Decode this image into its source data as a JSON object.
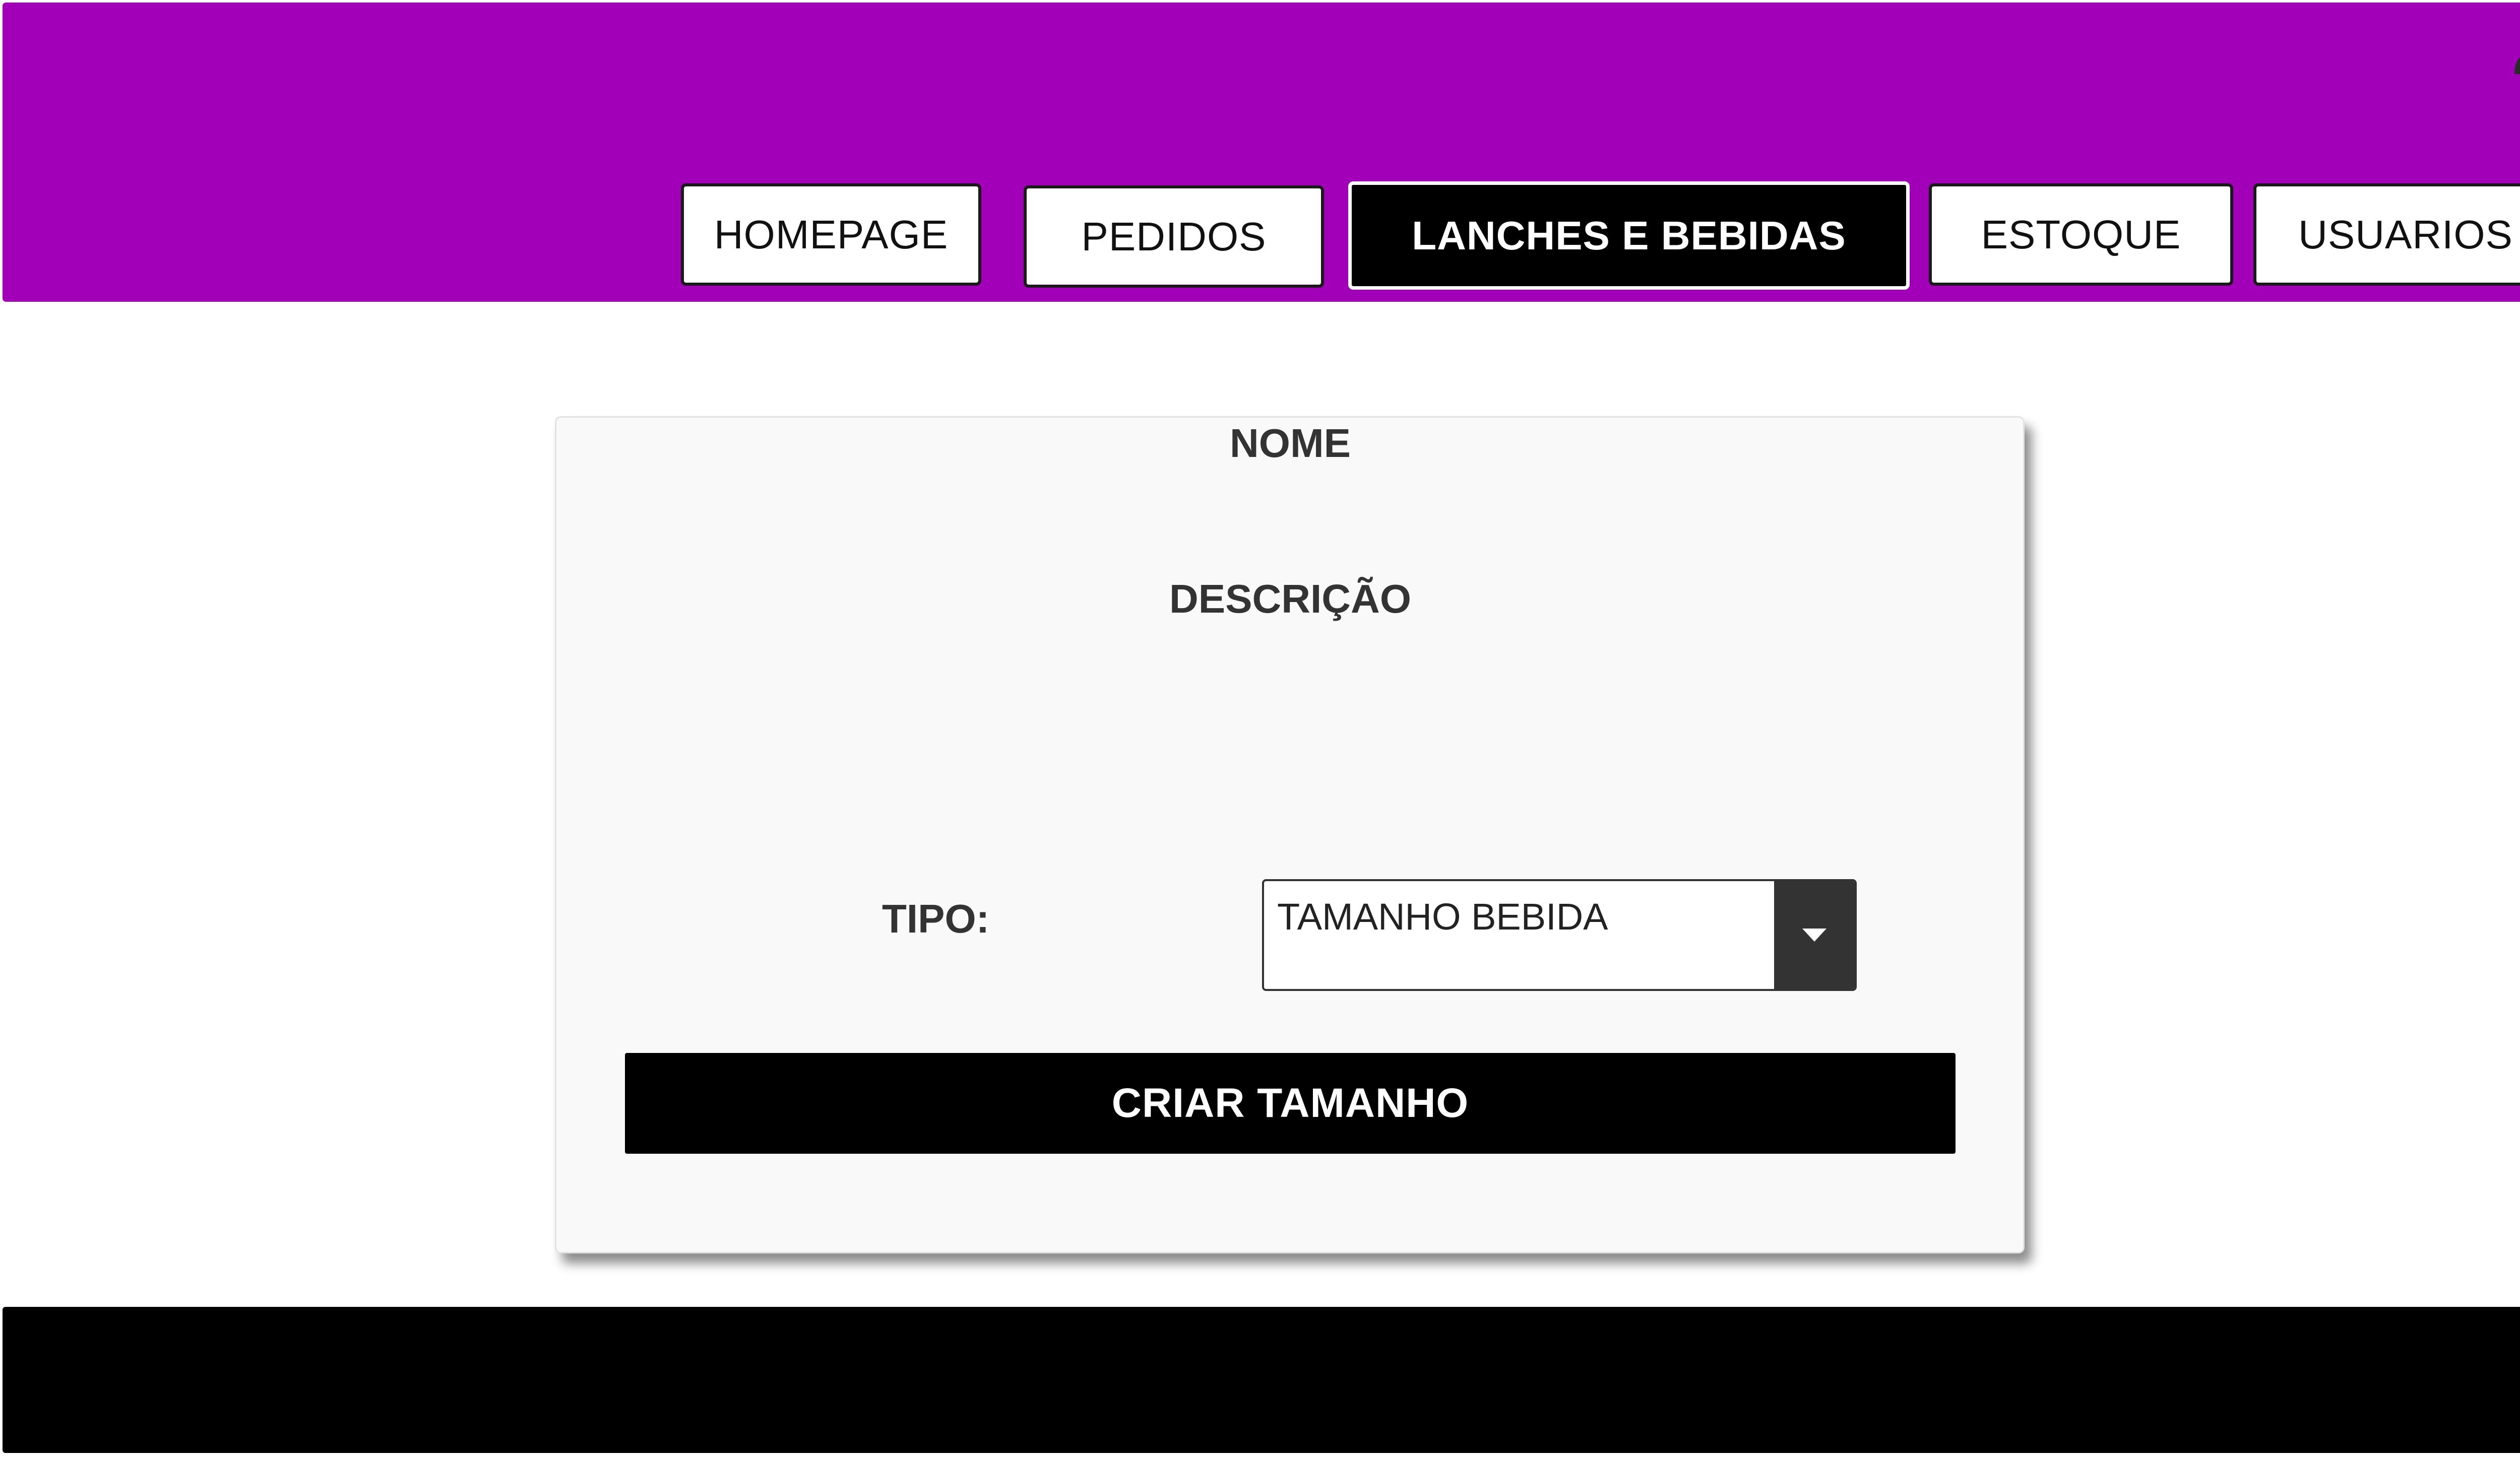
{
  "header": {
    "background_color": "#a100b8",
    "user_icon": "user-account-icon",
    "nav": [
      {
        "label": "HOMEPAGE",
        "active": false
      },
      {
        "label": "PEDIDOS",
        "active": false
      },
      {
        "label": "LANCHES E BEBIDAS",
        "active": true
      },
      {
        "label": "ESTOQUE",
        "active": false
      },
      {
        "label": "USUARIOS",
        "active": false
      }
    ]
  },
  "form": {
    "name_label": "NOME",
    "description_label": "DESCRIÇÃO",
    "type_label": "TIPO:",
    "type_select": {
      "selected": "TAMANHO BEBIDA",
      "icon": "caret-down-icon"
    },
    "submit_label": "CRIAR TAMANHO"
  },
  "footer": {
    "background_color": "#000000"
  }
}
